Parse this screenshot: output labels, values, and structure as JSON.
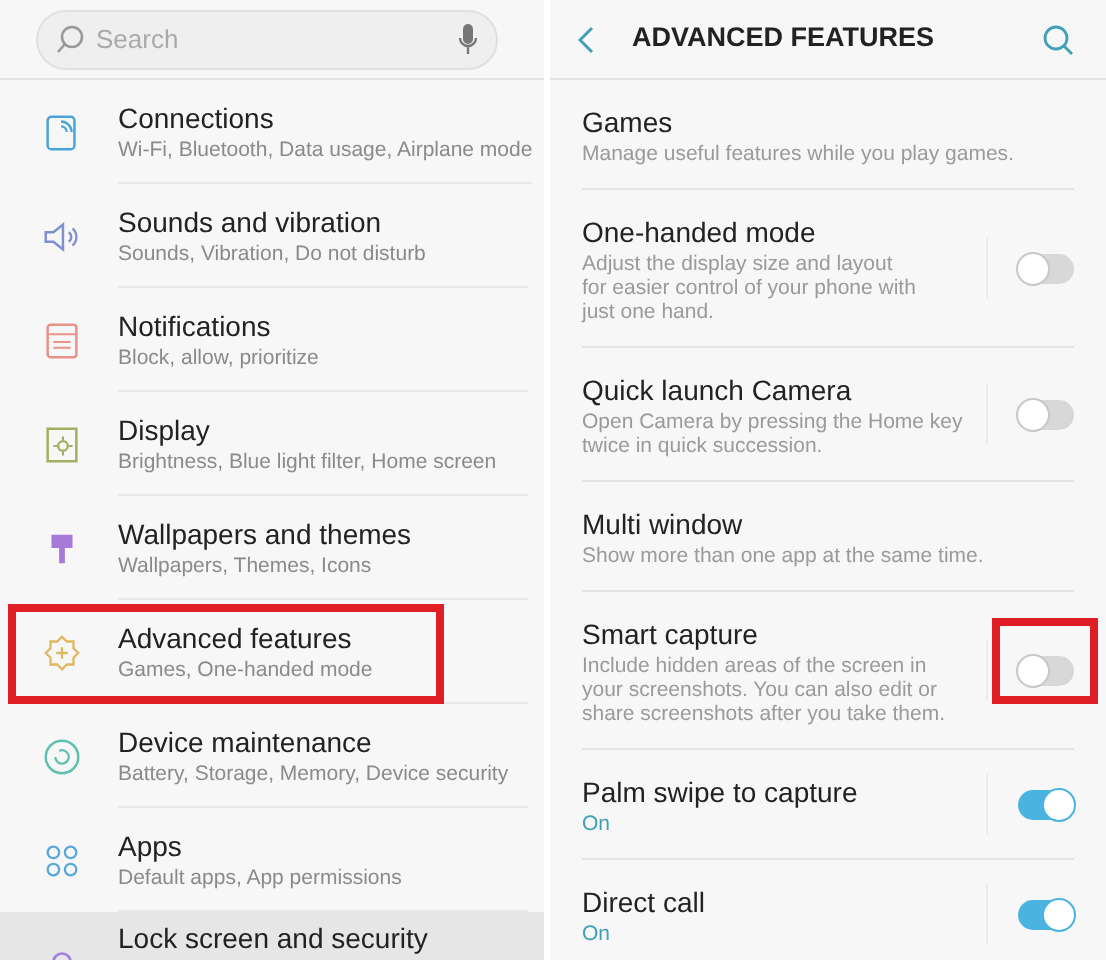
{
  "settings": {
    "search": {
      "placeholder": "Search"
    },
    "items": [
      {
        "title": "Connections",
        "subtitle": "Wi-Fi, Bluetooth, Data usage, Airplane mode",
        "kind": "connections",
        "color": "#4aa3d8",
        "pressed": false,
        "annotated": false
      },
      {
        "title": "Sounds and vibration",
        "subtitle": "Sounds, Vibration, Do not disturb",
        "kind": "sound",
        "color": "#7f8fcf",
        "pressed": false,
        "annotated": false
      },
      {
        "title": "Notifications",
        "subtitle": "Block, allow, prioritize",
        "kind": "notifications",
        "color": "#e8928a",
        "pressed": false,
        "annotated": false
      },
      {
        "title": "Display",
        "subtitle": "Brightness, Blue light filter, Home screen",
        "kind": "display",
        "color": "#9fb060",
        "pressed": false,
        "annotated": false
      },
      {
        "title": "Wallpapers and themes",
        "subtitle": "Wallpapers, Themes, Icons",
        "kind": "wallpapers",
        "color": "#a57ad8",
        "pressed": false,
        "annotated": false
      },
      {
        "title": "Advanced features",
        "subtitle": "Games, One-handed mode",
        "kind": "advanced",
        "color": "#e0b860",
        "pressed": false,
        "annotated": true
      },
      {
        "title": "Device maintenance",
        "subtitle": "Battery, Storage, Memory, Device security",
        "kind": "maintenance",
        "color": "#60c0b0",
        "pressed": false,
        "annotated": false
      },
      {
        "title": "Apps",
        "subtitle": "Default apps, App permissions",
        "kind": "apps",
        "color": "#5aa8d8",
        "pressed": false,
        "annotated": false
      },
      {
        "title": "Lock screen and security",
        "kind": "lock",
        "color": "#a080e0",
        "pressed": true,
        "annotated": false
      }
    ]
  },
  "advanced": {
    "title": "ADVANCED FEATURES",
    "items": [
      {
        "title": "Games",
        "subtitle": "Manage useful features while you play games."
      },
      {
        "title": "One-handed mode",
        "subtitle": "Adjust the display size and layout\nfor easier control of your phone with\njust one hand.",
        "on": false,
        "annotated": false
      },
      {
        "title": "Quick launch Camera",
        "subtitle": "Open Camera by pressing the Home key\ntwice in quick succession.",
        "on": false,
        "annotated": false
      },
      {
        "title": "Multi window",
        "subtitle": "Show more than one app at the same time."
      },
      {
        "title": "Smart capture",
        "subtitle": "Include hidden areas of the screen in\nyour screenshots. You can also edit or\nshare screenshots after you take them.",
        "on": false,
        "annotated": true
      },
      {
        "title": "Palm swipe to capture",
        "subtitle": "On",
        "on": true,
        "annotated": false
      },
      {
        "title": "Direct call",
        "subtitle": "On",
        "on": true,
        "annotated": false
      }
    ]
  }
}
